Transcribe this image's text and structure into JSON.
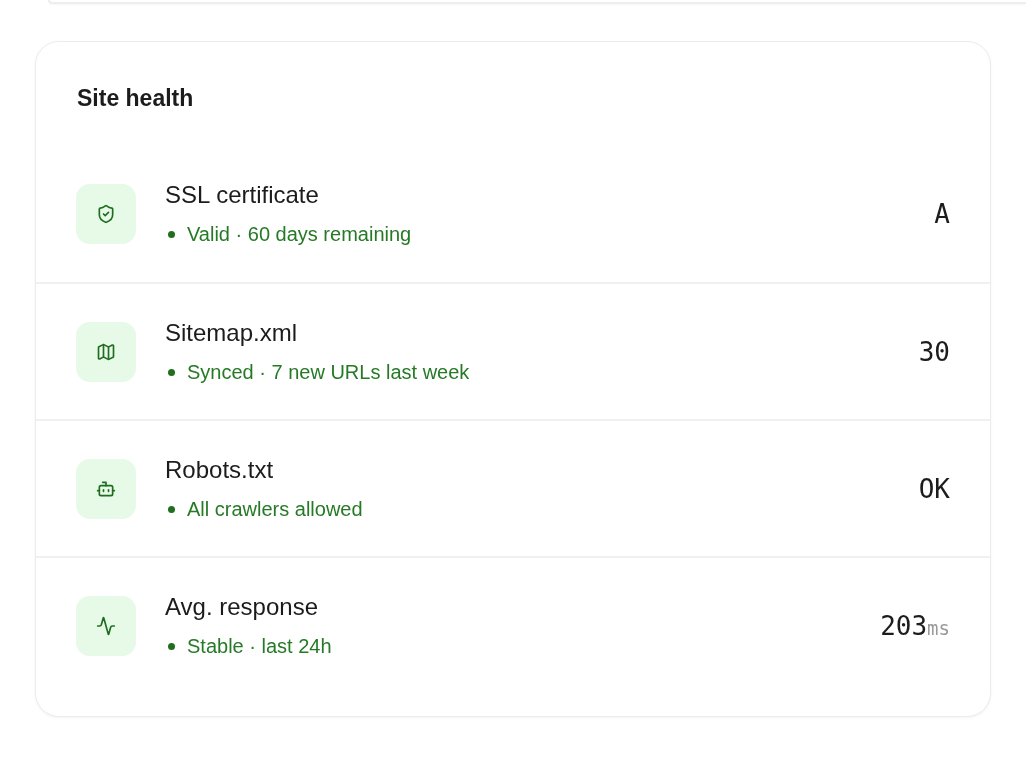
{
  "card": {
    "title": "Site health",
    "rows": [
      {
        "title": "SSL certificate",
        "healthy": true,
        "detail": "Valid · 60 days remaining",
        "value": "A"
      },
      {
        "title": "Sitemap.xml",
        "healthy": true,
        "detail": "Synced · 7 new URLs last week",
        "value": "30"
      },
      {
        "title": "Robots.txt",
        "healthy": true,
        "detail": "All crawlers allowed",
        "value": "OK"
      },
      {
        "title": "Avg. response",
        "healthy": true,
        "detail": "Stable · last 24h",
        "value": "203",
        "unit": "ms"
      }
    ]
  }
}
